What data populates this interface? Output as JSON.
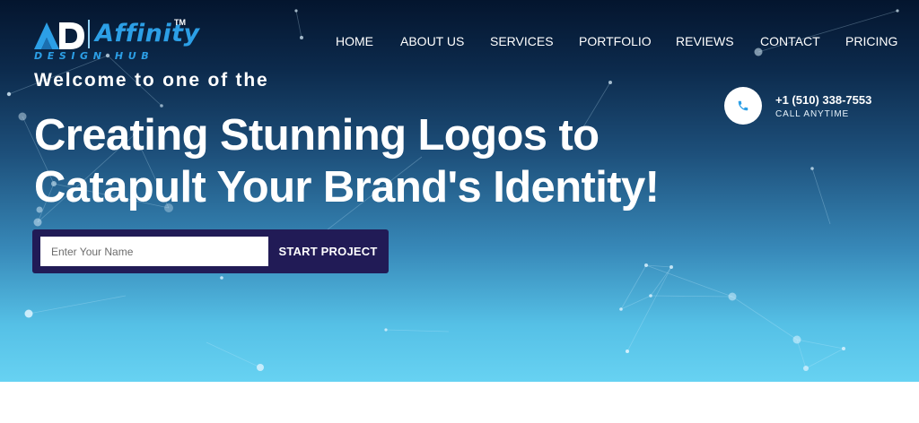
{
  "brand": {
    "name": "Affinity",
    "trademark": "TM",
    "tagline": "DESIGN HUB",
    "accent_color": "#2c9fe6"
  },
  "nav": {
    "items": [
      {
        "label": "HOME"
      },
      {
        "label": "ABOUT US"
      },
      {
        "label": "SERVICES"
      },
      {
        "label": "PORTFOLIO"
      },
      {
        "label": "REVIEWS"
      },
      {
        "label": "CONTACT"
      },
      {
        "label": "PRICING"
      }
    ]
  },
  "hero": {
    "welcome": "Welcome to one of the",
    "headline_line1": "Creating Stunning Logos to",
    "headline_line2": "Catapult Your Brand's Identity!",
    "background_top_color": "#04152e",
    "background_bottom_color": "#67d2f2"
  },
  "contact": {
    "icon": "phone-icon",
    "phone": "+1 (510) 338-7553",
    "caption": "CALL ANYTIME"
  },
  "form": {
    "name_placeholder": "Enter Your Name",
    "name_value": "",
    "submit_label": "START PROJECT",
    "panel_color": "#211b56"
  }
}
